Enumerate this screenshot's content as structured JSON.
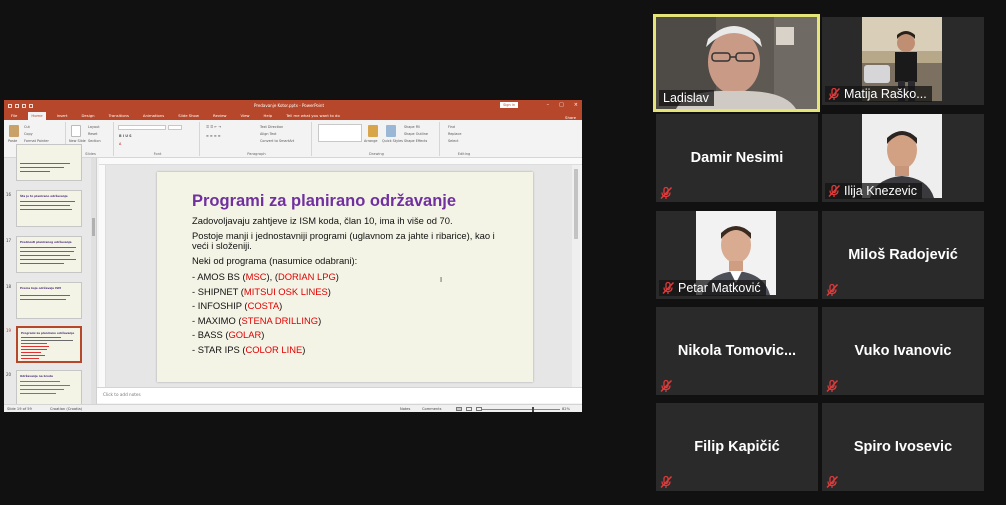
{
  "powerpoint": {
    "window_title": "Predavanje Kotor.pptx  -  PowerPoint",
    "sign_in": "Sign in",
    "share": "Share",
    "ribbon_tabs": [
      "File",
      "Home",
      "Insert",
      "Design",
      "Transitions",
      "Animations",
      "Slide Show",
      "Review",
      "View",
      "Help",
      "Tell me what you want to do"
    ],
    "ribbon_groups": {
      "clipboard": "Clipboard",
      "slides": "Slides",
      "font": "Font",
      "paragraph": "Paragraph",
      "drawing": "Drawing",
      "editing": "Editing"
    },
    "clipboard_items": [
      "Cut",
      "Copy",
      "Format Painter"
    ],
    "paste": "Paste",
    "slide_items": [
      "Layout",
      "Reset",
      "Section"
    ],
    "new_slide": "New Slide",
    "paragraph_items": [
      "Text Direction",
      "Align Text",
      "Convert to SmartArt"
    ],
    "drawing_items": [
      "Shape Fill",
      "Shape Outline",
      "Shape Effects"
    ],
    "arrange": "Arrange",
    "quick_styles": "Quick Styles",
    "editing_items": [
      "Find",
      "Replace",
      "Select"
    ],
    "thumbnails": [
      {
        "num": "",
        "title": ""
      },
      {
        "num": "16",
        "title": "Šta je to planirano održavanje"
      },
      {
        "num": "17",
        "title": "Prednosti planiranog održavanja"
      },
      {
        "num": "18",
        "title": "Prema koje održavaju ISM"
      },
      {
        "num": "19",
        "title": "Programi za planirano održavanje"
      },
      {
        "num": "20",
        "title": "Održavanje na brodu"
      }
    ],
    "slide": {
      "title": "Programi za planirano održavanje",
      "para1": "Zadovoljavaju zahtjeve iz ISM koda, član 10, ima ih više od 70.",
      "para2": "Postoje manji i jednostavniji programi (uglavnom za jahte i ribarice), kao i veći i složeniji.",
      "para3": "Neki od programa (nasumice odabrani):",
      "items": [
        {
          "prefix": "-  AMOS BS (",
          "red1": "MSC",
          "mid": "), (",
          "red2": "DORIAN LPG",
          "suffix": ")"
        },
        {
          "prefix": "-  SHIPNET (",
          "red1": "MITSUI OSK LINES",
          "mid": "",
          "red2": "",
          "suffix": ")"
        },
        {
          "prefix": "-  INFOSHIP (",
          "red1": "COSTA",
          "mid": "",
          "red2": "",
          "suffix": ")"
        },
        {
          "prefix": "-  MAXIMO (",
          "red1": "STENA DRILLING",
          "mid": "",
          "red2": "",
          "suffix": ")"
        },
        {
          "prefix": "-  BASS (",
          "red1": "GOLAR",
          "mid": "",
          "red2": "",
          "suffix": ")"
        },
        {
          "prefix": "-  STAR IPS (",
          "red1": "COLOR LINE",
          "mid": "",
          "red2": "",
          "suffix": ")"
        }
      ]
    },
    "notes_placeholder": "Click to add notes",
    "status": {
      "slide_counter": "Slide 19 of 59",
      "language": "Croatian (Croatia)",
      "notes": "Notes",
      "comments": "Comments",
      "zoom": "82%"
    }
  },
  "participants": [
    {
      "id": "ladislav",
      "name": "Ladislav",
      "has_video": true,
      "muted": false
    },
    {
      "id": "matija",
      "name": "Matija Raško...",
      "has_video": true,
      "muted": true
    },
    {
      "id": "damir",
      "name": "Damir Nesimi",
      "has_video": false,
      "muted": true
    },
    {
      "id": "ilija",
      "name": "Ilija Knezevic",
      "has_video": true,
      "muted": true
    },
    {
      "id": "petar",
      "name": "Petar Matković",
      "has_video": true,
      "muted": true
    },
    {
      "id": "milos",
      "name": "Miloš Radojević",
      "has_video": false,
      "muted": true
    },
    {
      "id": "nikola",
      "name": "Nikola  Tomovic...",
      "has_video": false,
      "muted": true
    },
    {
      "id": "vuko",
      "name": "Vuko Ivanovic",
      "has_video": false,
      "muted": true
    },
    {
      "id": "filip",
      "name": "Filip Kapičić",
      "has_video": false,
      "muted": true
    },
    {
      "id": "spiro",
      "name": "Spiro Ivosevic",
      "has_video": false,
      "muted": true
    }
  ],
  "colors": {
    "ppt_accent": "#b7472a",
    "slide_title": "#7030a0",
    "highlight_red": "#e00000",
    "active_speaker_border": "#e4e478",
    "mute_icon": "#e03a3a"
  }
}
